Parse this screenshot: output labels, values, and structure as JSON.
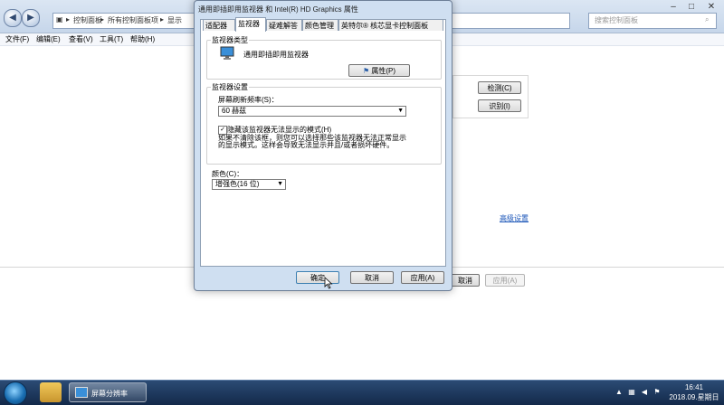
{
  "explorer": {
    "breadcrumb": [
      "控制面板",
      "所有控制面板项",
      "显示"
    ],
    "search_placeholder": "搜索控制面板",
    "menu": [
      "文件(F)",
      "编辑(E)",
      "查看(V)",
      "工具(T)",
      "帮助(H)"
    ],
    "detect_label": "检测(C)",
    "identify_label": "识别(I)",
    "advanced_link": "高级设置",
    "cancel_label": "取消",
    "apply_label": "应用(A)"
  },
  "dialog": {
    "title": "通用即插即用监视器 和 Intel(R) HD Graphics 属性",
    "tabs": [
      "适配器",
      "监视器",
      "疑难解答",
      "颜色管理",
      "英特尔® 核芯显卡控制面板"
    ],
    "monitor_type_label": "监视器类型",
    "monitor_name": "通用即插即用监视器",
    "properties_label": "属性(P)",
    "settings_label": "监视器设置",
    "refresh_label": "屏幕刷新频率(S)：",
    "refresh_value": "60 赫兹",
    "hide_modes_label": "隐藏该监视器无法显示的模式(H)",
    "hide_modes_checked": true,
    "warning_text": "如果不清除该框，则您可以选择那些该监视器无法正常显示的显示模式。这样会导致无法显示并且/或者损坏硬件。",
    "color_label": "颜色(C)：",
    "color_value": "增强色(16 位)",
    "ok_label": "确定",
    "cancel_label": "取消",
    "apply_label": "应用(A)"
  },
  "taskbar": {
    "active_window_label": "屏幕分辨率",
    "time": "16:41",
    "date": "2018.09.星期日"
  }
}
